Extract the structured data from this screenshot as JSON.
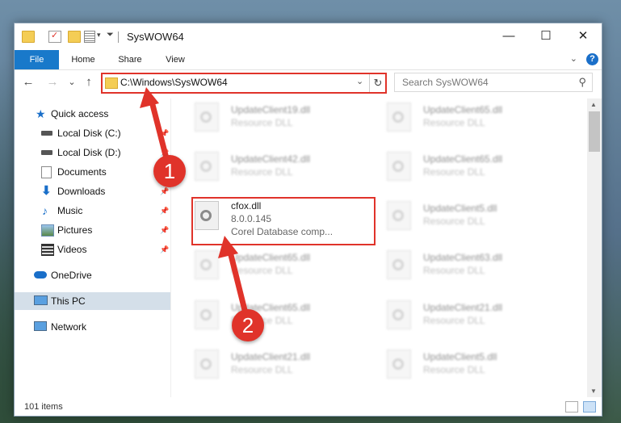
{
  "window": {
    "title": "SysWOW64",
    "controls": {
      "minimize": "—",
      "maximize": "☐",
      "close": "✕"
    }
  },
  "ribbon": {
    "tabs": [
      "File",
      "Home",
      "Share",
      "View"
    ],
    "expand": "⌄",
    "help": "?"
  },
  "nav": {
    "back": "←",
    "forward": "→",
    "recent": "⌄",
    "up": "↑",
    "address": "C:\\Windows\\SysWOW64",
    "address_dropdown": "⌄",
    "refresh": "↻",
    "search_placeholder": "Search SysWOW64",
    "search_icon": "⚲"
  },
  "sidebar": {
    "items": [
      {
        "label": "Quick access",
        "icon": "star-icon"
      },
      {
        "label": "Local Disk (C:)",
        "icon": "drive-icon"
      },
      {
        "label": "Local Disk (D:)",
        "icon": "drive-icon"
      },
      {
        "label": "Documents",
        "icon": "documents-icon"
      },
      {
        "label": "Downloads",
        "icon": "download-icon"
      },
      {
        "label": "Music",
        "icon": "music-icon"
      },
      {
        "label": "Pictures",
        "icon": "pictures-icon"
      },
      {
        "label": "Videos",
        "icon": "videos-icon"
      },
      {
        "label": "OneDrive",
        "icon": "cloud-icon"
      },
      {
        "label": "This PC",
        "icon": "computer-icon"
      },
      {
        "label": "Network",
        "icon": "network-icon"
      }
    ],
    "pin": "📌"
  },
  "files": {
    "left": [
      {
        "name": "UpdateClient19.dll",
        "desc": "Resource DLL"
      },
      {
        "name": "UpdateClient42.dll",
        "desc": "Resource DLL"
      },
      {
        "name": "cfox.dll",
        "version": "8.0.0.145",
        "desc": "Corel Database comp..."
      },
      {
        "name": "UpdateClient65.dll",
        "desc": "Resource DLL"
      },
      {
        "name": "UpdateClient65.dll",
        "desc": "Resource DLL"
      },
      {
        "name": "UpdateClient21.dll",
        "desc": "Resource DLL"
      }
    ],
    "right": [
      {
        "name": "UpdateClient65.dll",
        "desc": "Resource DLL"
      },
      {
        "name": "UpdateClient65.dll",
        "desc": "Resource DLL"
      },
      {
        "name": "UpdateClient5.dll",
        "desc": "Resource DLL"
      },
      {
        "name": "UpdateClient63.dll",
        "desc": "Resource DLL"
      },
      {
        "name": "UpdateClient21.dll",
        "desc": "Resource DLL"
      },
      {
        "name": "UpdateClient5.dll",
        "desc": "Resource DLL"
      }
    ]
  },
  "status": {
    "count": "101 items"
  },
  "annotations": {
    "step1": "1",
    "step2": "2",
    "color": "#e0332a"
  }
}
